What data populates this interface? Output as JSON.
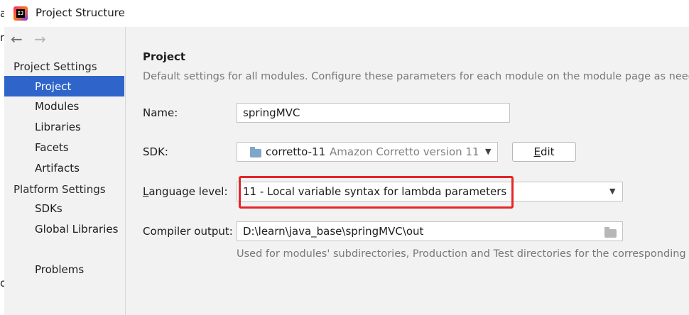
{
  "window": {
    "title": "Project Structure",
    "left_partial_chars": [
      "a",
      "r",
      "o"
    ]
  },
  "sidebar": {
    "back_icon": "←",
    "forward_icon": "→",
    "project_settings_heading": "Project Settings",
    "project_settings_items": [
      "Project",
      "Modules",
      "Libraries",
      "Facets",
      "Artifacts"
    ],
    "platform_settings_heading": "Platform Settings",
    "platform_settings_items": [
      "SDKs",
      "Global Libraries"
    ],
    "problems_label": "Problems",
    "selected": "Project"
  },
  "main": {
    "section_title": "Project",
    "description": "Default settings for all modules. Configure these parameters for each module on the module page as needed.",
    "name_label": "Name:",
    "name_value": "springMVC",
    "sdk_label": "SDK:",
    "sdk_name": "corretto-11",
    "sdk_detail": "Amazon Corretto version 11.",
    "edit_button": "Edit",
    "language_level_label_u": "L",
    "language_level_label_rest": "anguage level:",
    "language_level_value": "11 - Local variable syntax for lambda parameters",
    "compiler_output_label": "Compiler output:",
    "compiler_output_value": "D:\\learn\\java_base\\springMVC\\out",
    "compiler_output_hint": "Used for modules' subdirectories, Production and Test directories for the corresponding modules."
  },
  "colors": {
    "selection": "#2f65ca",
    "highlight": "#e3262a",
    "background": "#f2f2f2"
  }
}
